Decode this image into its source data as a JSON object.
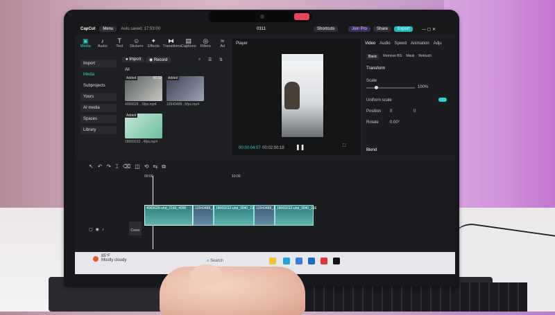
{
  "app": {
    "name": "CapCut",
    "menu_label": "Menu",
    "autosave": "Auto saved: 17:53:00",
    "project_title": "0311",
    "shortcuts": "Shortcuts",
    "join_pro": "Join Pro",
    "share": "Share",
    "export": "Export"
  },
  "toolbar": {
    "items": [
      {
        "label": "Media",
        "icon": "media-icon",
        "active": true
      },
      {
        "label": "Audio",
        "icon": "audio-icon"
      },
      {
        "label": "Text",
        "icon": "text-icon"
      },
      {
        "label": "Stickers",
        "icon": "stickers-icon"
      },
      {
        "label": "Effects",
        "icon": "effects-icon"
      },
      {
        "label": "Transitions",
        "icon": "transitions-icon"
      },
      {
        "label": "Captions",
        "icon": "captions-icon"
      },
      {
        "label": "Filters",
        "icon": "filters-icon"
      },
      {
        "label": "Ad",
        "icon": "adjust-icon"
      }
    ]
  },
  "leftnav": {
    "import": "Import",
    "media": "Media",
    "subprojects": "Subprojects",
    "yours": "Yours",
    "ai_media": "AI media",
    "spaces": "Spaces",
    "library": "Library"
  },
  "media_panel": {
    "import_btn": "Import",
    "record_btn": "Record",
    "filter_all": "All",
    "items": [
      {
        "added": "Added",
        "duration": "00:32",
        "filename": "4065629 ...5fps.mp4"
      },
      {
        "added": "Added",
        "duration": "",
        "filename": "12943488...5fps.mp4"
      },
      {
        "added": "Added",
        "duration": "",
        "filename": "18069232...4fps.mp4"
      }
    ]
  },
  "player": {
    "title": "Player",
    "current_time": "00:00:04:07",
    "total_time": "00:02:00:18"
  },
  "inspector": {
    "tabs": [
      "Video",
      "Audio",
      "Speed",
      "Animation",
      "Adju"
    ],
    "subtabs": [
      "Basic",
      "Remove BG",
      "Mask",
      "Retouch"
    ],
    "transform": "Transform",
    "scale_label": "Scale",
    "scale_value": "100%",
    "scale_percent": 100,
    "uniform_scale": "Uniform scale",
    "position_label": "Position",
    "position_x": "0",
    "position_y": "0",
    "rotate_label": "Rotate",
    "rotate_value": "0.00°",
    "blend": "Blend"
  },
  "timeline": {
    "ruler_marks": [
      "00:00",
      "10:00"
    ],
    "cover_label": "Cover",
    "clips": [
      {
        "label": "4065629-uhd_2160_4096"
      },
      {
        "label": "12943488_1"
      },
      {
        "label": "18069232-uhd_3840_216"
      },
      {
        "label": "12943488_1"
      },
      {
        "label": "18069232-uhd_3840_216"
      }
    ]
  },
  "taskbar": {
    "temperature": "85°F",
    "weather": "Mostly cloudy",
    "search": "Search"
  }
}
